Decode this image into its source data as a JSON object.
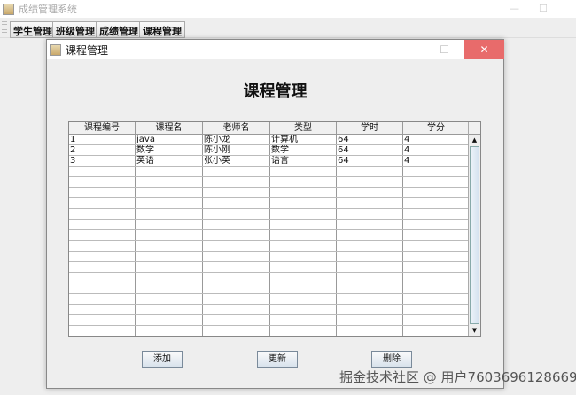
{
  "app": {
    "title": "成绩管理系统",
    "toolbar": [
      "学生管理",
      "班级管理",
      "成绩管理",
      "课程管理"
    ]
  },
  "dialog": {
    "title": "课程管理",
    "heading": "课程管理",
    "minimize": "—",
    "maximize": "☐",
    "close": "✕"
  },
  "table": {
    "columns": [
      "课程编号",
      "课程名",
      "老师名",
      "类型",
      "学时",
      "学分"
    ],
    "rows": [
      [
        "1",
        "java",
        "陈小龙",
        "计算机",
        "64",
        "4"
      ],
      [
        "2",
        "数学",
        "陈小刚",
        "数学",
        "64",
        "4"
      ],
      [
        "3",
        "英语",
        "张小英",
        "语言",
        "64",
        "4"
      ]
    ]
  },
  "buttons": {
    "add": "添加",
    "update": "更新",
    "delete": "删除"
  },
  "watermark": "掘金技术社区 @ 用户7603696128669"
}
